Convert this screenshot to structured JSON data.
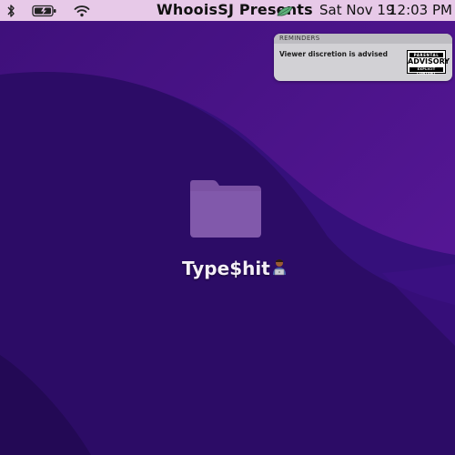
{
  "menubar": {
    "icons": [
      "bluetooth-icon",
      "battery-charging-icon",
      "wifi-icon"
    ],
    "title": "WhooisSJ Presents",
    "title_icon": "leaf-icon",
    "date": "Sat Nov 19",
    "time": "12:03 PM"
  },
  "notification": {
    "app": "REMINDERS",
    "message": "Viewer discretion is advised",
    "badge": {
      "top": "PARENTAL",
      "middle": "ADVISORY",
      "bottom": "EXPLICIT CONTENT"
    }
  },
  "desktop": {
    "folder_label": "Type$hit",
    "folder_emoji": "technologist-emoji"
  },
  "colors": {
    "wallpaper_light": "#5a1499",
    "wallpaper_dark": "#2a0a5e",
    "menubar": "#e7c9e8",
    "folder": "#7f56a6"
  }
}
